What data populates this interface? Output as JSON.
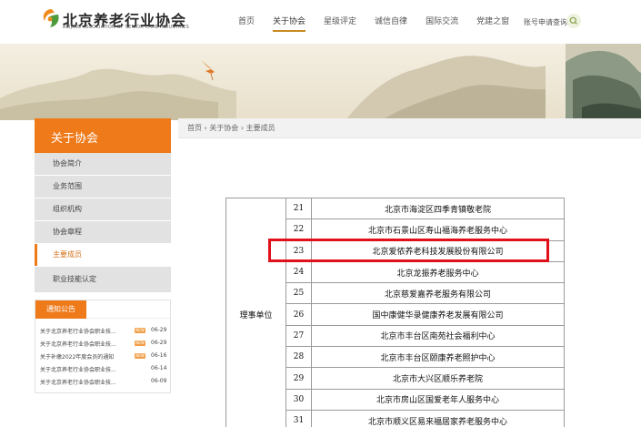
{
  "header": {
    "org_name": "北京养老行业协会",
    "org_name_en": "BEIJING ASSOCIATION OF SENIOR CARE INDUSTRIES",
    "nav": [
      "首页",
      "关于协会",
      "星级评定",
      "诚信自律",
      "国际交流",
      "党建之窗"
    ],
    "nav_active": "关于协会",
    "account_link": "账号申请查询",
    "search_icon": "search-icon"
  },
  "sidebar": {
    "title": "关于协会",
    "items": [
      "协会简介",
      "业务范围",
      "组织机构",
      "协会章程",
      "主要成员",
      "职业技能认定"
    ],
    "active": "主要成员"
  },
  "notice": {
    "title": "通知公告",
    "items": [
      {
        "text": "关于北京养老行业协会职业技...",
        "date": "06-29",
        "new": "NEW"
      },
      {
        "text": "关于北京养老行业协会职业技...",
        "date": "06-29",
        "new": "NEW"
      },
      {
        "text": "关于补缴2022年度会员的通知",
        "date": "06-16",
        "new": "NEW"
      },
      {
        "text": "关于北京养老行业协会职业技...",
        "date": "06-14",
        "new": ""
      },
      {
        "text": "关于北京养老行业协会职业技...",
        "date": "06-09",
        "new": ""
      }
    ]
  },
  "breadcrumb": "首页 › 关于协会 › 主要成员",
  "members": {
    "unit_label": "理事单位",
    "rows": [
      {
        "no": "21",
        "name": "北京市海淀区四季青镇敬老院"
      },
      {
        "no": "22",
        "name": "北京市石景山区寿山福海养老服务中心"
      },
      {
        "no": "23",
        "name": "北京爱侬养老科技发展股份有限公司"
      },
      {
        "no": "24",
        "name": "北京龙振养老服务中心"
      },
      {
        "no": "25",
        "name": "北京慈爱嘉养老服务有限公司"
      },
      {
        "no": "26",
        "name": "国中康健华录健康养老发展有限公司"
      },
      {
        "no": "27",
        "name": "北京市丰台区南苑社会福利中心"
      },
      {
        "no": "28",
        "name": "北京市丰台区颐康养老照护中心"
      },
      {
        "no": "29",
        "name": "北京市大兴区顺乐养老院"
      },
      {
        "no": "30",
        "name": "北京市房山区国爱老年人服务中心"
      },
      {
        "no": "31",
        "name": "北京市顺义区易来福居家养老服务中心"
      }
    ],
    "highlighted_row": 2
  },
  "colors": {
    "accent_orange": "#ef7a1a",
    "highlight_red": "#e0111b",
    "nav_underline": "#c98a25"
  }
}
